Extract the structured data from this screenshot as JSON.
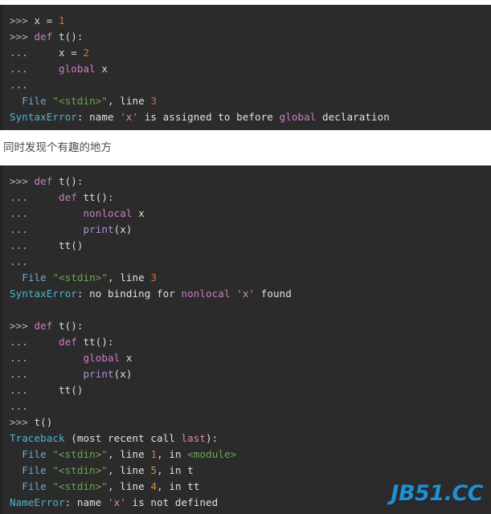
{
  "document": {
    "background_color": "#ffffff",
    "code_background_color": "#2b2b2b"
  },
  "block_one": {
    "name": "python-repl-global-error",
    "lines": [
      [
        {
          "t": ">>> ",
          "c": "prompt"
        },
        {
          "t": "x = ",
          "c": "plain"
        },
        {
          "t": "1",
          "c": "num"
        }
      ],
      [
        {
          "t": ">>> ",
          "c": "prompt"
        },
        {
          "t": "def ",
          "c": "kw"
        },
        {
          "t": "t():",
          "c": "plain"
        }
      ],
      [
        {
          "t": "...     ",
          "c": "prompt"
        },
        {
          "t": "x = ",
          "c": "plain"
        },
        {
          "t": "2",
          "c": "num"
        }
      ],
      [
        {
          "t": "...     ",
          "c": "prompt"
        },
        {
          "t": "global ",
          "c": "kw"
        },
        {
          "t": "x",
          "c": "plain"
        }
      ],
      [
        {
          "t": "...",
          "c": "prompt"
        }
      ],
      [
        {
          "t": "  ",
          "c": "plain"
        },
        {
          "t": "File ",
          "c": "file"
        },
        {
          "t": "\"<stdin>\"",
          "c": "green"
        },
        {
          "t": ", line ",
          "c": "white"
        },
        {
          "t": "3",
          "c": "num"
        }
      ],
      [
        {
          "t": "SyntaxError",
          "c": "err"
        },
        {
          "t": ": name ",
          "c": "white"
        },
        {
          "t": "'x'",
          "c": "str"
        },
        {
          "t": " is assigned to before ",
          "c": "white"
        },
        {
          "t": "global",
          "c": "kw"
        },
        {
          "t": " declaration",
          "c": "white"
        }
      ]
    ]
  },
  "prose": {
    "text": "同时发现个有趣的地方"
  },
  "block_two": {
    "name": "python-repl-nonlocal-and-nameerror",
    "lines": [
      [
        {
          "t": ">>> ",
          "c": "prompt"
        },
        {
          "t": "def ",
          "c": "kw"
        },
        {
          "t": "t():",
          "c": "plain"
        }
      ],
      [
        {
          "t": "...     ",
          "c": "prompt"
        },
        {
          "t": "def ",
          "c": "kw"
        },
        {
          "t": "tt():",
          "c": "plain"
        }
      ],
      [
        {
          "t": "...         ",
          "c": "prompt"
        },
        {
          "t": "nonlocal ",
          "c": "kw"
        },
        {
          "t": "x",
          "c": "plain"
        }
      ],
      [
        {
          "t": "...         ",
          "c": "prompt"
        },
        {
          "t": "print",
          "c": "builtin"
        },
        {
          "t": "(x)",
          "c": "plain"
        }
      ],
      [
        {
          "t": "...     ",
          "c": "prompt"
        },
        {
          "t": "tt()",
          "c": "plain"
        }
      ],
      [
        {
          "t": "...",
          "c": "prompt"
        }
      ],
      [
        {
          "t": "  ",
          "c": "plain"
        },
        {
          "t": "File ",
          "c": "file"
        },
        {
          "t": "\"<stdin>\"",
          "c": "green"
        },
        {
          "t": ", line ",
          "c": "white"
        },
        {
          "t": "3",
          "c": "num"
        }
      ],
      [
        {
          "t": "SyntaxError",
          "c": "err"
        },
        {
          "t": ": no binding for ",
          "c": "white"
        },
        {
          "t": "nonlocal",
          "c": "kw"
        },
        {
          "t": " ",
          "c": "white"
        },
        {
          "t": "'x'",
          "c": "str"
        },
        {
          "t": " found",
          "c": "white"
        }
      ],
      [
        {
          "t": "",
          "c": "plain"
        }
      ],
      [
        {
          "t": ">>> ",
          "c": "prompt"
        },
        {
          "t": "def ",
          "c": "kw"
        },
        {
          "t": "t():",
          "c": "plain"
        }
      ],
      [
        {
          "t": "...     ",
          "c": "prompt"
        },
        {
          "t": "def ",
          "c": "kw"
        },
        {
          "t": "tt():",
          "c": "plain"
        }
      ],
      [
        {
          "t": "...         ",
          "c": "prompt"
        },
        {
          "t": "global ",
          "c": "kw"
        },
        {
          "t": "x",
          "c": "plain"
        }
      ],
      [
        {
          "t": "...         ",
          "c": "prompt"
        },
        {
          "t": "print",
          "c": "builtin"
        },
        {
          "t": "(x)",
          "c": "plain"
        }
      ],
      [
        {
          "t": "...     ",
          "c": "prompt"
        },
        {
          "t": "tt()",
          "c": "plain"
        }
      ],
      [
        {
          "t": "...",
          "c": "prompt"
        }
      ],
      [
        {
          "t": ">>> ",
          "c": "prompt"
        },
        {
          "t": "t()",
          "c": "plain"
        }
      ],
      [
        {
          "t": "Traceback",
          "c": "err"
        },
        {
          "t": " (most recent call ",
          "c": "white"
        },
        {
          "t": "last",
          "c": "str"
        },
        {
          "t": "):",
          "c": "white"
        }
      ],
      [
        {
          "t": "  ",
          "c": "plain"
        },
        {
          "t": "File ",
          "c": "file"
        },
        {
          "t": "\"<stdin>\"",
          "c": "green"
        },
        {
          "t": ", line ",
          "c": "white"
        },
        {
          "t": "1",
          "c": "num"
        },
        {
          "t": ", in ",
          "c": "white"
        },
        {
          "t": "<module>",
          "c": "green"
        }
      ],
      [
        {
          "t": "  ",
          "c": "plain"
        },
        {
          "t": "File ",
          "c": "file"
        },
        {
          "t": "\"<stdin>\"",
          "c": "green"
        },
        {
          "t": ", line ",
          "c": "white"
        },
        {
          "t": "5",
          "c": "num2"
        },
        {
          "t": ", in t",
          "c": "white"
        }
      ],
      [
        {
          "t": "  ",
          "c": "plain"
        },
        {
          "t": "File ",
          "c": "file"
        },
        {
          "t": "\"<stdin>\"",
          "c": "green"
        },
        {
          "t": ", line ",
          "c": "white"
        },
        {
          "t": "4",
          "c": "num2"
        },
        {
          "t": ", in tt",
          "c": "white"
        }
      ],
      [
        {
          "t": "NameError",
          "c": "err"
        },
        {
          "t": ": name ",
          "c": "white"
        },
        {
          "t": "'x'",
          "c": "str"
        },
        {
          "t": " is not defined",
          "c": "white"
        }
      ]
    ]
  },
  "watermark": {
    "text": "JB51.CC",
    "color": "#1f8fd6"
  }
}
